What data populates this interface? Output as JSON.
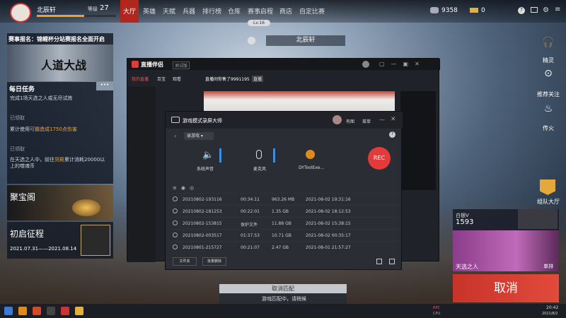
{
  "header": {
    "username": "北辰轩",
    "level_label": "等级",
    "level": "27",
    "tabs": [
      "大厅",
      "英雄",
      "天赋",
      "兵器",
      "排行榜",
      "仓库",
      "赛事启程",
      "商店",
      "自定比赛"
    ],
    "currency1": "9358",
    "currency2": "0",
    "level_badge": "Lv.16",
    "center_name": "北辰轩"
  },
  "left": {
    "event_title": "赛事报名：锦鲤杯分站赛报名全面开启",
    "brand": "人道大战",
    "daily_title": "每日任务",
    "more": "•••",
    "tasks": [
      {
        "text": "完成1场天选之人或无尽试炼",
        "state": "已领取"
      },
      {
        "text_a": "累计使用",
        "text_b": "可霸造成1750点伤害",
        "state": "已领取"
      },
      {
        "text_a": "在天选之人中，前往",
        "text_b": "货殿",
        "text_c": "累计消耗20000以上的噬魂币",
        "state": ""
      }
    ],
    "jubao": "聚宝阁",
    "chushi": "初启征程",
    "dates": "2021.07.31——2021.08.14"
  },
  "right": {
    "items": [
      "精灵",
      "推荐关注",
      "传火",
      "组队大厅"
    ],
    "cancel_small": "取消",
    "rank_name": "白银V",
    "rank_points": "1593",
    "tianxuan": "天选之人",
    "danpai": "单排",
    "cancel_big": "取消"
  },
  "bottom": {
    "cancel_match": "取消匹配",
    "matching": "游戏匹配中，请稍候"
  },
  "streamer": {
    "app": "直播伴侣",
    "badge": "测试版",
    "tabs": [
      "我的直播",
      "百宝",
      "观看"
    ],
    "room_title": "直播间你售了9991195",
    "live": "直播"
  },
  "recorder": {
    "title": "游戏模式录屏大师",
    "tools": [
      "有图",
      "菜单"
    ],
    "mode": "录游戏",
    "audio": [
      {
        "label": "系统声音"
      },
      {
        "label": "麦克风"
      },
      {
        "label": "DYToolExe..."
      }
    ],
    "rec": "REC",
    "rows": [
      [
        "20210802-193116",
        "00:34:11",
        "963.26 MB",
        "2021-08-02 19:31:16"
      ],
      [
        "20210802-181253",
        "00:22:01",
        "1.35 GB",
        "2021-08-02 18:12:53"
      ],
      [
        "20210802-153815",
        "保护文件",
        "11.88 GB",
        "2021-08-02 15:38:15"
      ],
      [
        "20210802-003517",
        "01:37:53",
        "10.71 GB",
        "2021-08-02 00:35:17"
      ],
      [
        "20210801-215727",
        "00:21:07",
        "2.47 GB",
        "2021-08-01 21:57:27"
      ]
    ],
    "btn1": "文件夹",
    "btn2": "批量删除"
  },
  "taskbar": {
    "time": "20:42",
    "date": "2021/8/2",
    "net": "RPC",
    "sys": "CPU"
  }
}
